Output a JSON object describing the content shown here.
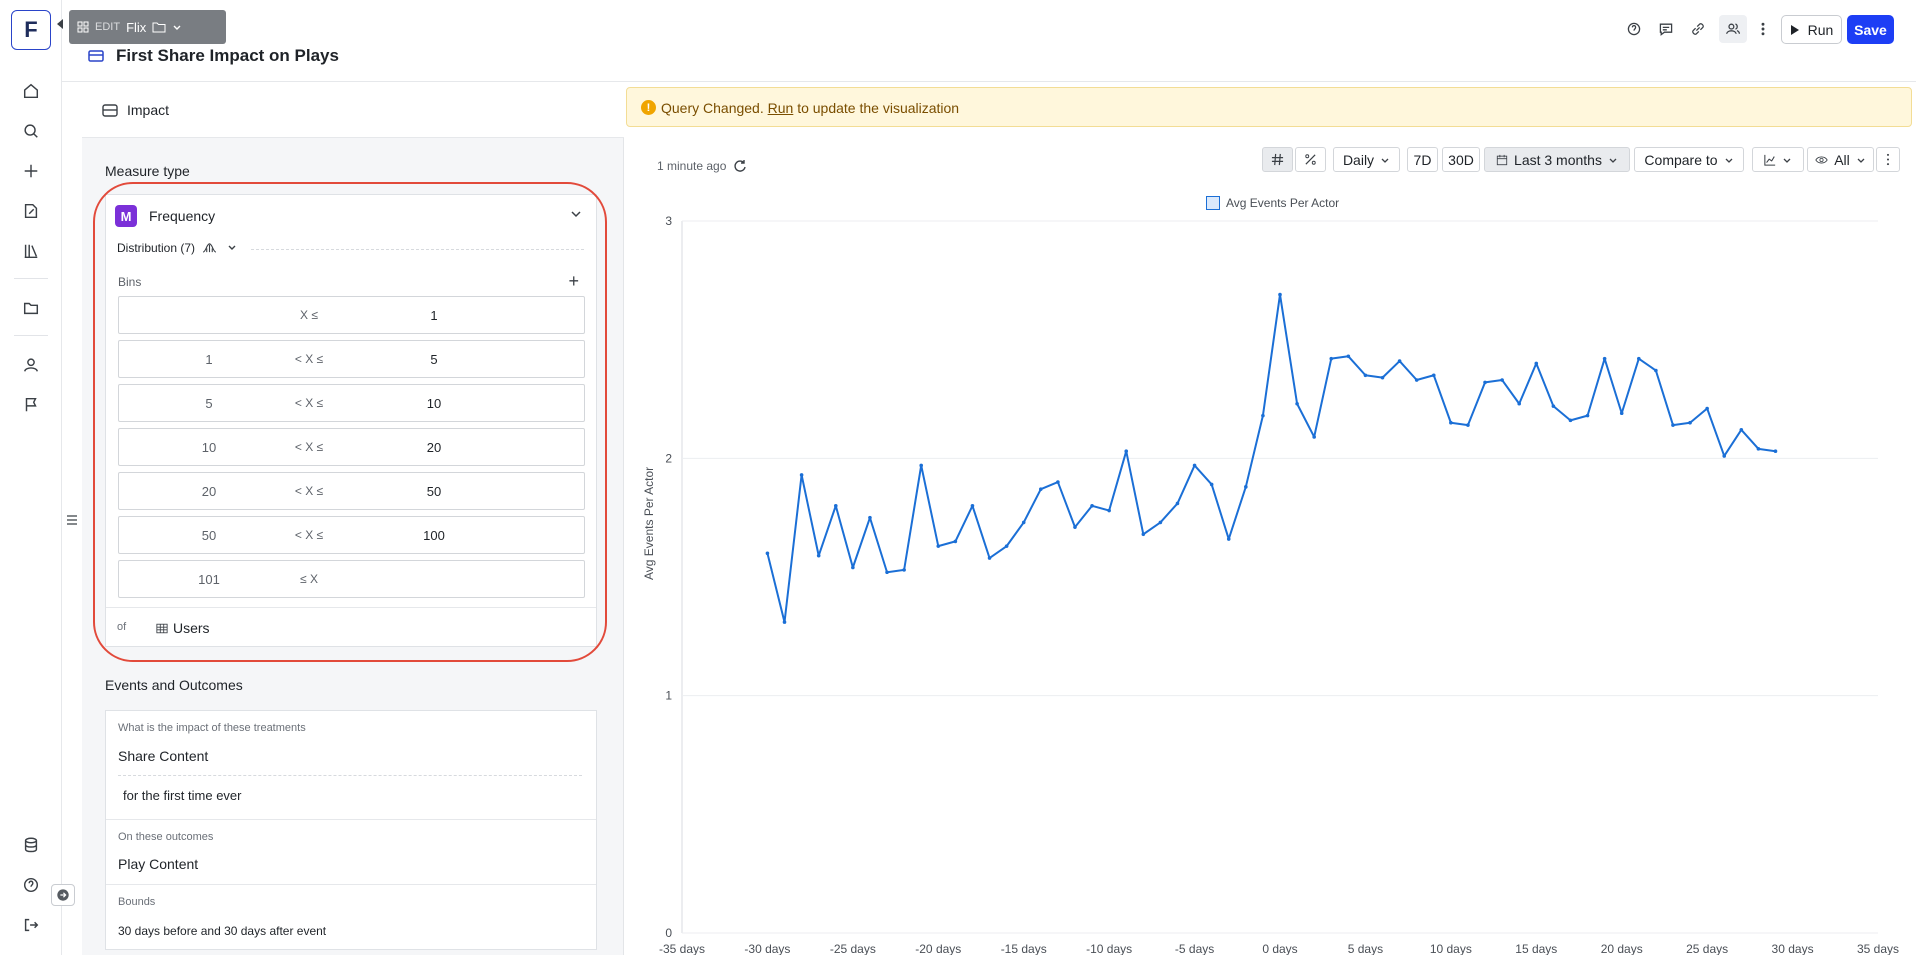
{
  "app": {
    "logo_letter": "F",
    "edit_badge": "EDIT",
    "workspace": "Flix"
  },
  "header": {
    "title": "First Share Impact on Plays",
    "run_label": "Run",
    "save_label": "Save"
  },
  "left_panel": {
    "tab_label": "Impact",
    "measure_type_title": "Measure type",
    "measure": {
      "badge": "M",
      "label": "Frequency",
      "distribution_label": "Distribution (7)",
      "bins_label": "Bins",
      "bins": [
        {
          "lo": "",
          "op": "X ≤",
          "hi": "1"
        },
        {
          "lo": "1",
          "op": "< X ≤",
          "hi": "5"
        },
        {
          "lo": "5",
          "op": "< X ≤",
          "hi": "10"
        },
        {
          "lo": "10",
          "op": "< X ≤",
          "hi": "20"
        },
        {
          "lo": "20",
          "op": "< X ≤",
          "hi": "50"
        },
        {
          "lo": "50",
          "op": "< X ≤",
          "hi": "100"
        },
        {
          "lo": "101",
          "op": "≤ X",
          "hi": ""
        }
      ],
      "of_label": "of",
      "of_value": "Users"
    },
    "events_title": "Events and Outcomes",
    "treatments_caption": "What is the impact of these treatments",
    "treatment": "Share Content",
    "treatment_qualifier": "for the first time ever",
    "outcomes_caption": "On these outcomes",
    "outcome": "Play Content",
    "bounds_caption": "Bounds",
    "bounds_value": "30 days before and 30 days after event"
  },
  "right_panel": {
    "banner": {
      "prefix": "Query Changed. ",
      "link": "Run",
      "suffix": " to update the visualization"
    },
    "updated": "1 minute ago",
    "toolbar": {
      "granularity": "Daily",
      "range_7d": "7D",
      "range_30d": "30D",
      "date_range": "Last 3 months",
      "compare": "Compare to",
      "visibility": "All"
    }
  },
  "colors": {
    "accent": "#1d3ef5",
    "line": "#1b6fd6",
    "highlight": "#e24a3b",
    "banner_bg": "#fff7dc"
  },
  "chart_data": {
    "type": "line",
    "legend": "Avg Events Per Actor",
    "ylabel": "Avg Events Per Actor",
    "xlabel": "",
    "ylim": [
      0,
      3
    ],
    "xlim": [
      -35,
      35
    ],
    "yticks": [
      "0",
      "1",
      "2",
      "3"
    ],
    "xticks": [
      "-35 days",
      "-30 days",
      "-25 days",
      "-20 days",
      "-15 days",
      "-10 days",
      "-5 days",
      "0 days",
      "5 days",
      "10 days",
      "15 days",
      "20 days",
      "25 days",
      "30 days",
      "35 days"
    ],
    "grid": true,
    "series": [
      {
        "name": "Avg Events Per Actor",
        "x": [
          -30,
          -29,
          -28,
          -27,
          -26,
          -25,
          -24,
          -23,
          -22,
          -21,
          -20,
          -19,
          -18,
          -17,
          -16,
          -15,
          -14,
          -13,
          -12,
          -11,
          -10,
          -9,
          -8,
          -7,
          -6,
          -5,
          -4,
          -3,
          -2,
          -1,
          0,
          1,
          2,
          3,
          4,
          5,
          6,
          7,
          8,
          9,
          10,
          11,
          12,
          13,
          14,
          15,
          16,
          17,
          18,
          19,
          20,
          21,
          22,
          23,
          24,
          25,
          26,
          27,
          28,
          29
        ],
        "y": [
          1.6,
          1.31,
          1.93,
          1.59,
          1.8,
          1.54,
          1.75,
          1.52,
          1.53,
          1.97,
          1.63,
          1.65,
          1.8,
          1.58,
          1.63,
          1.73,
          1.87,
          1.9,
          1.71,
          1.8,
          1.78,
          2.03,
          1.68,
          1.73,
          1.81,
          1.97,
          1.89,
          1.66,
          1.88,
          2.18,
          2.69,
          2.23,
          2.09,
          2.42,
          2.43,
          2.35,
          2.34,
          2.41,
          2.33,
          2.35,
          2.15,
          2.14,
          2.32,
          2.33,
          2.23,
          2.4,
          2.22,
          2.16,
          2.18,
          2.42,
          2.19,
          2.42,
          2.37,
          2.14,
          2.15,
          2.21,
          2.01,
          2.12,
          2.04,
          2.03
        ]
      }
    ]
  }
}
